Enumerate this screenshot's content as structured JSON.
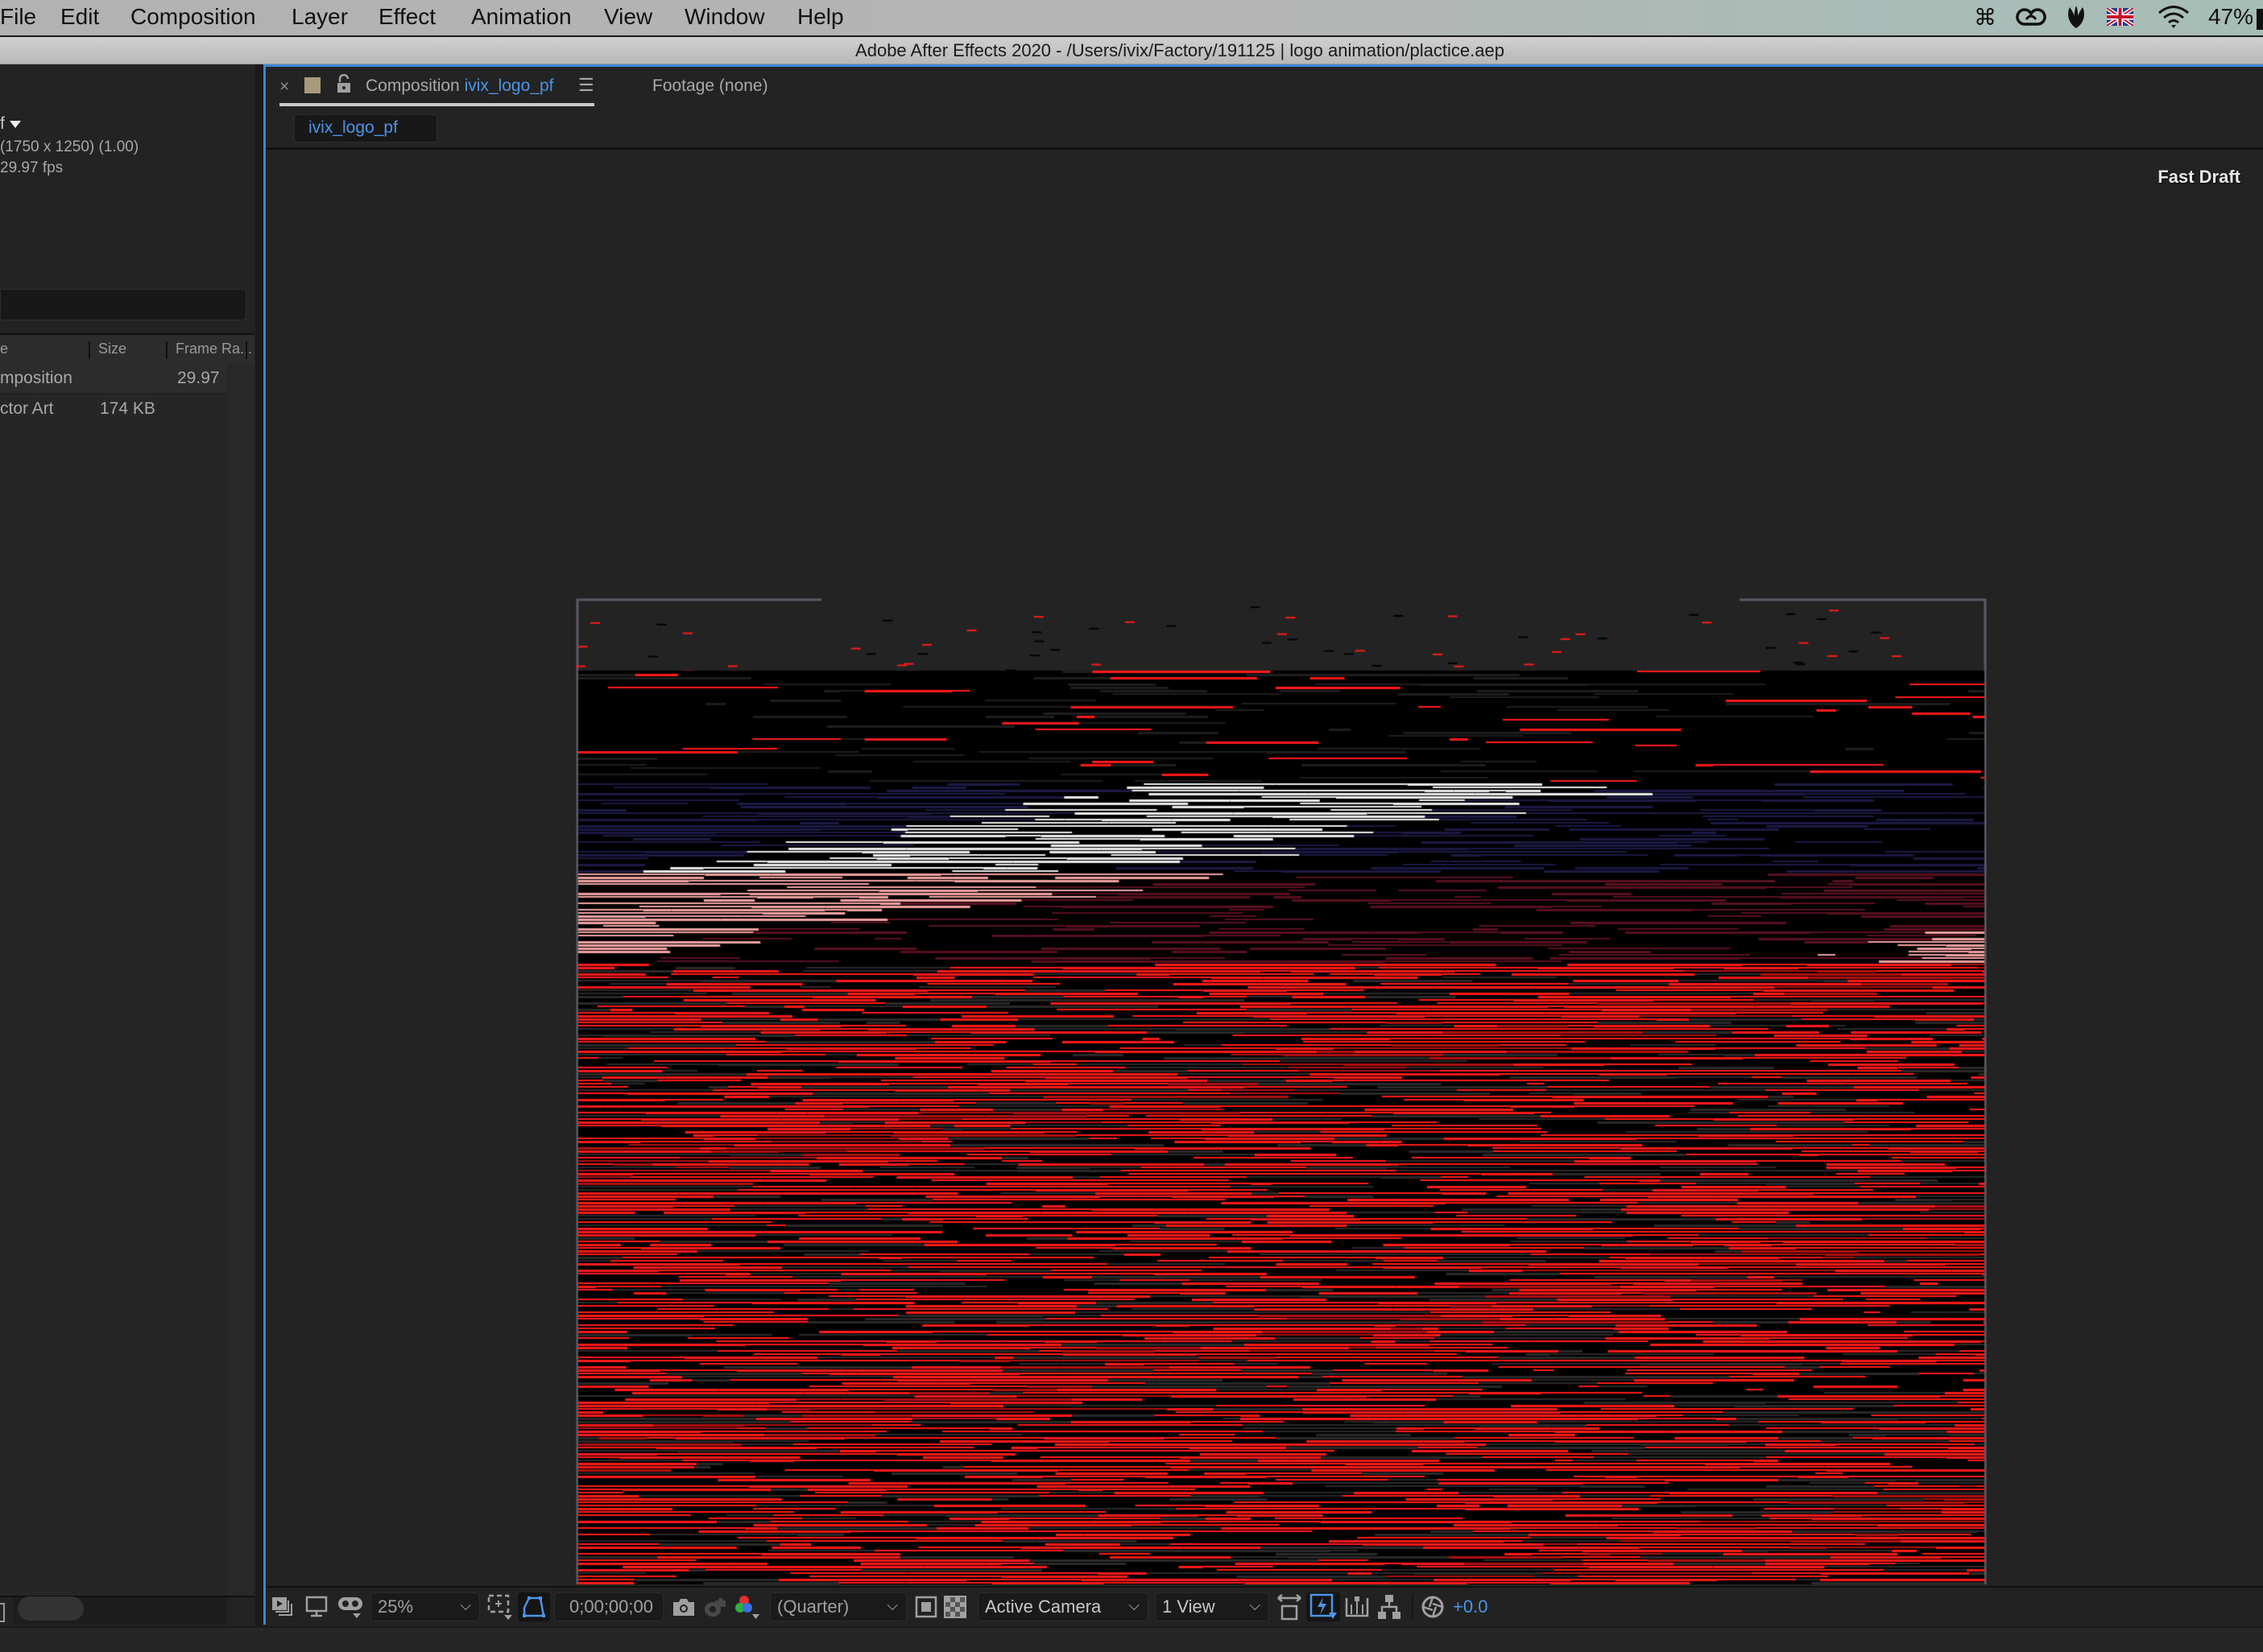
{
  "menubar": {
    "items": [
      "File",
      "Edit",
      "Composition",
      "Layer",
      "Effect",
      "Animation",
      "View",
      "Window",
      "Help"
    ],
    "status": {
      "icons": [
        "command-icon",
        "creative-cloud-icon",
        "leaf-icon",
        "uk-flag-icon",
        "wifi-icon"
      ],
      "battery_percent": "47%"
    }
  },
  "titlebar": {
    "title": "Adobe After Effects 2020 - /Users/ivix/Factory/191125 | logo animation/plactice.aep"
  },
  "project_panel": {
    "selected_name_fragment": "f",
    "dimensions": "(1750 x 1250) (1.00)",
    "fps": "29.97 fps",
    "search_placeholder": "",
    "columns": [
      "e",
      "Size",
      "Frame Ra..."
    ],
    "rows": [
      {
        "type": "mposition",
        "size": "",
        "frame_rate": "29.97",
        "has_flowchart_icon": true
      },
      {
        "type": "ctor Art",
        "size": "174 KB",
        "frame_rate": ""
      }
    ]
  },
  "composition_panel": {
    "tab_prefix": "Composition",
    "tab_comp_name": "ivix_logo_pf",
    "footage_tab": "Footage (none)",
    "sub_tab": "ivix_logo_pf",
    "render_mode": "Fast Draft",
    "label_color": "#a89a7c",
    "accent_color": "#3d86d8",
    "preview_colors": {
      "red": "#ff1a1a",
      "pink": "#f0a0a0",
      "white": "#e8e8e8",
      "dark": "#000000",
      "navy": "#1c1a45"
    }
  },
  "viewer_toolbar": {
    "zoom": "25%",
    "timecode": "0;00;00;00",
    "resolution": "(Quarter)",
    "camera": "Active Camera",
    "views": "1 View",
    "exposure": "+0.0"
  }
}
